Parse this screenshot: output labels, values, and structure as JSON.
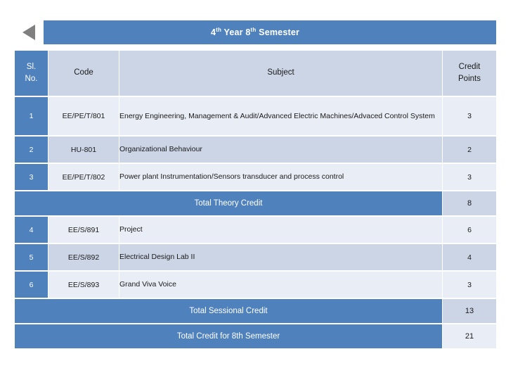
{
  "header": {
    "back_icon": "back-triangle-icon",
    "title_prefix": "4",
    "title_sup1": "th",
    "title_mid": " Year 8",
    "title_sup2": "th",
    "title_suffix": " Semester",
    "title_plain": "4th Year 8th Semester"
  },
  "colors": {
    "accent_blue": "#4f81bd",
    "row_light": "#e9edf5",
    "row_dark": "#ccd5e6",
    "page_bg": "#ffffff",
    "back_glyph": "#808080"
  },
  "table": {
    "columns": [
      "Sl. No.",
      "Code",
      "Subject",
      "Credit Points"
    ],
    "col_sl_line1": "Sl.",
    "col_sl_line2": "No.",
    "col_code": "Code",
    "col_subject": "Subject",
    "col_credit_line1": "Credit",
    "col_credit_line2": "Points",
    "theory_rows": [
      {
        "sl": "1",
        "code": "EE/PE/T/801",
        "subject": "Energy Engineering, Management & Audit/Advanced Electric Machines/Advaced Control System",
        "credit": "3"
      },
      {
        "sl": "2",
        "code": "HU-801",
        "subject": "Organizational Behaviour",
        "credit": "2"
      },
      {
        "sl": "3",
        "code": "EE/PE/T/802",
        "subject": "Power plant Instrumentation/Sensors transducer and process control",
        "credit": "3"
      }
    ],
    "theory_total": {
      "label": "Total Theory Credit",
      "value": "8"
    },
    "sessional_rows": [
      {
        "sl": "4",
        "code": "EE/S/891",
        "subject": "Project",
        "credit": "6"
      },
      {
        "sl": "5",
        "code": "EE/S/892",
        "subject": "Electrical Design Lab II",
        "credit": "4"
      },
      {
        "sl": "6",
        "code": "EE/S/893",
        "subject": "Grand Viva Voice",
        "credit": "3"
      }
    ],
    "sessional_total": {
      "label": "Total Sessional Credit",
      "value": "13"
    },
    "grand_total": {
      "label": "Total Credit for 8th Semester",
      "value": "21"
    }
  }
}
